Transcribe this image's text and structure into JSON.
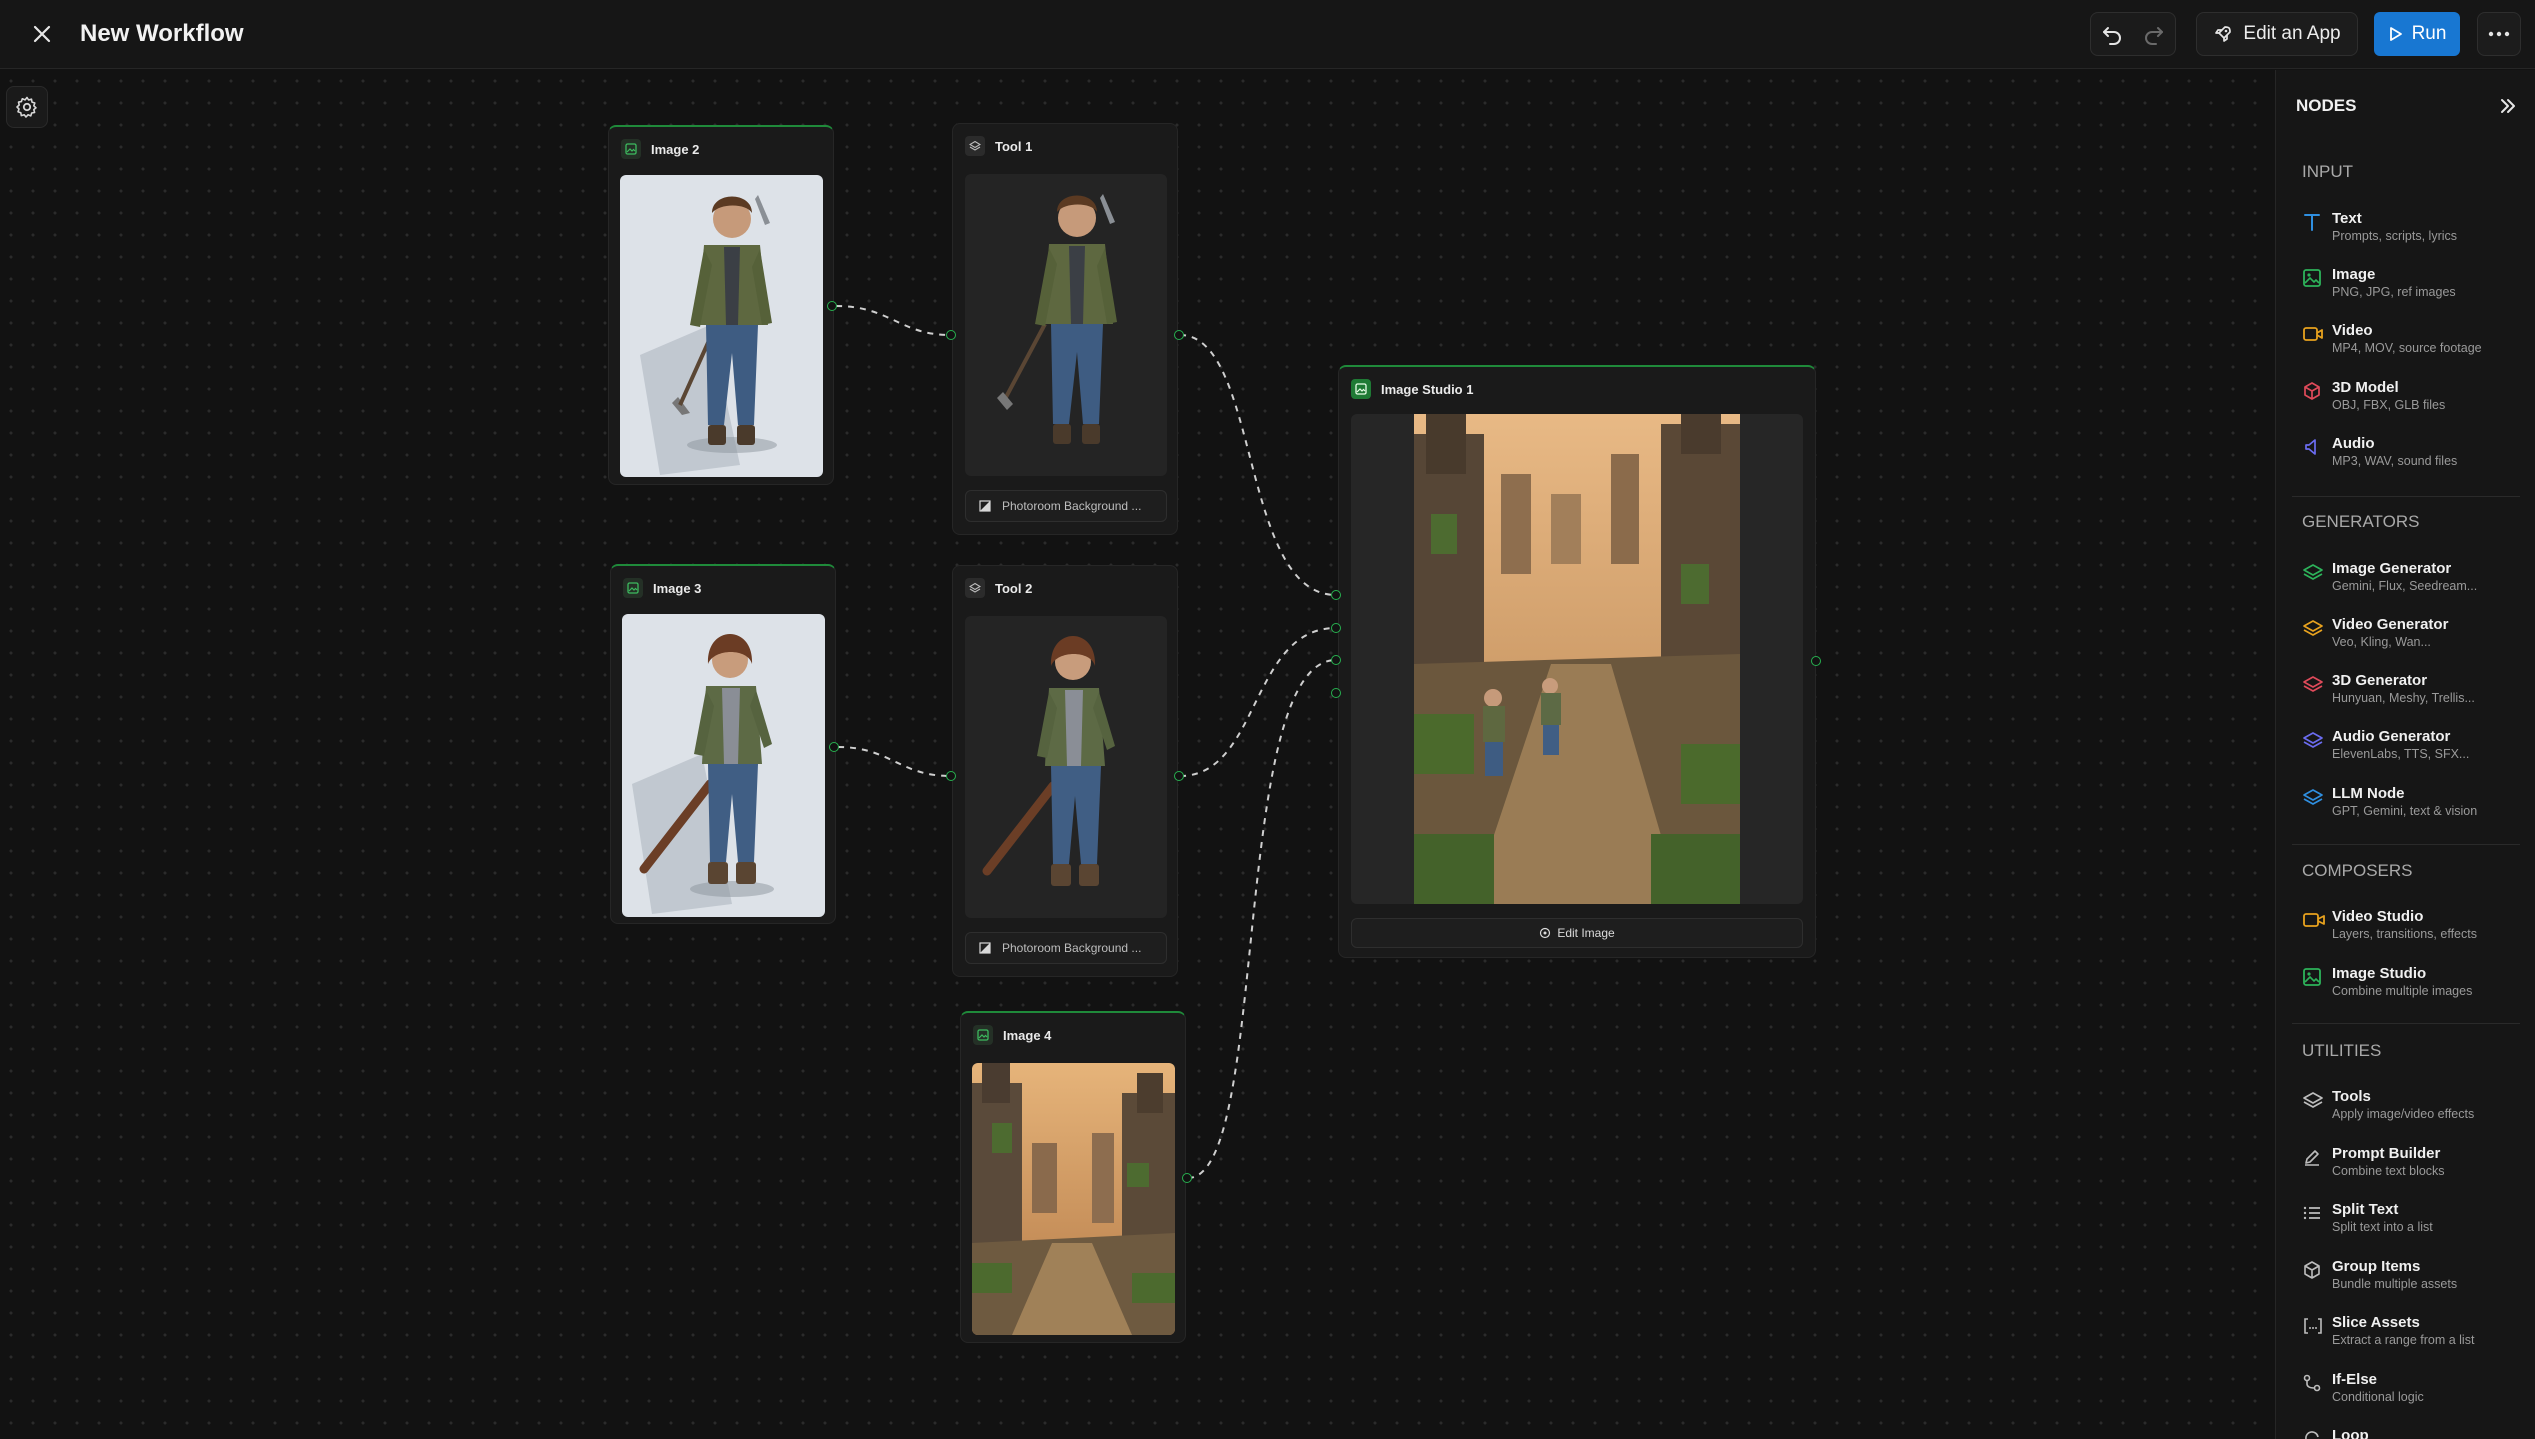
{
  "header": {
    "title": "New Workflow",
    "edit_app_label": "Edit an App",
    "run_label": "Run"
  },
  "canvas": {
    "nodes": {
      "image2": {
        "title": "Image 2"
      },
      "image3": {
        "title": "Image 3"
      },
      "image4": {
        "title": "Image 4"
      },
      "tool1": {
        "title": "Tool 1",
        "footer": "Photoroom Background ..."
      },
      "tool2": {
        "title": "Tool 2",
        "footer": "Photoroom Background ..."
      },
      "studio1": {
        "title": "Image Studio 1",
        "action_label": "Edit Image"
      }
    }
  },
  "sidebar": {
    "title": "NODES",
    "sections": {
      "input": "INPUT",
      "generators": "GENERATORS",
      "composers": "COMPOSERS",
      "utilities": "UTILITIES"
    },
    "items": {
      "text": {
        "name": "Text",
        "desc": "Prompts, scripts, lyrics",
        "icon": "text-icon"
      },
      "image": {
        "name": "Image",
        "desc": "PNG, JPG, ref images",
        "icon": "image-icon"
      },
      "video": {
        "name": "Video",
        "desc": "MP4, MOV, source footage",
        "icon": "video-icon"
      },
      "model3d": {
        "name": "3D Model",
        "desc": "OBJ, FBX, GLB files",
        "icon": "cube-icon"
      },
      "audio": {
        "name": "Audio",
        "desc": "MP3, WAV, sound files",
        "icon": "speaker-icon"
      },
      "image_gen": {
        "name": "Image Generator",
        "desc": "Gemini, Flux, Seedream...",
        "icon": "layers-icon"
      },
      "video_gen": {
        "name": "Video Generator",
        "desc": "Veo, Kling, Wan...",
        "icon": "layers-icon"
      },
      "gen3d": {
        "name": "3D Generator",
        "desc": "Hunyuan, Meshy, Trellis...",
        "icon": "layers-icon"
      },
      "audio_gen": {
        "name": "Audio Generator",
        "desc": "ElevenLabs, TTS, SFX...",
        "icon": "layers-icon"
      },
      "llm": {
        "name": "LLM Node",
        "desc": "GPT, Gemini, text & vision",
        "icon": "layers-icon"
      },
      "video_studio": {
        "name": "Video Studio",
        "desc": "Layers, transitions, effects",
        "icon": "video-icon"
      },
      "image_studio": {
        "name": "Image Studio",
        "desc": "Combine multiple images",
        "icon": "image-icon"
      },
      "tools": {
        "name": "Tools",
        "desc": "Apply image/video effects",
        "icon": "layers-icon"
      },
      "prompt_builder": {
        "name": "Prompt Builder",
        "desc": "Combine text blocks",
        "icon": "pen-icon"
      },
      "split_text": {
        "name": "Split Text",
        "desc": "Split text into a list",
        "icon": "list-icon"
      },
      "group_items": {
        "name": "Group Items",
        "desc": "Bundle multiple assets",
        "icon": "box-icon"
      },
      "slice_assets": {
        "name": "Slice Assets",
        "desc": "Extract a range from a list",
        "icon": "brackets-icon"
      },
      "if_else": {
        "name": "If-Else",
        "desc": "Conditional logic",
        "icon": "branch-icon"
      },
      "loop": {
        "name": "Loop",
        "desc": "",
        "icon": "loop-icon"
      }
    }
  },
  "colors": {
    "accent": "#1877d2",
    "node_selected": "#1f8a3a",
    "port": "#27b04f"
  }
}
